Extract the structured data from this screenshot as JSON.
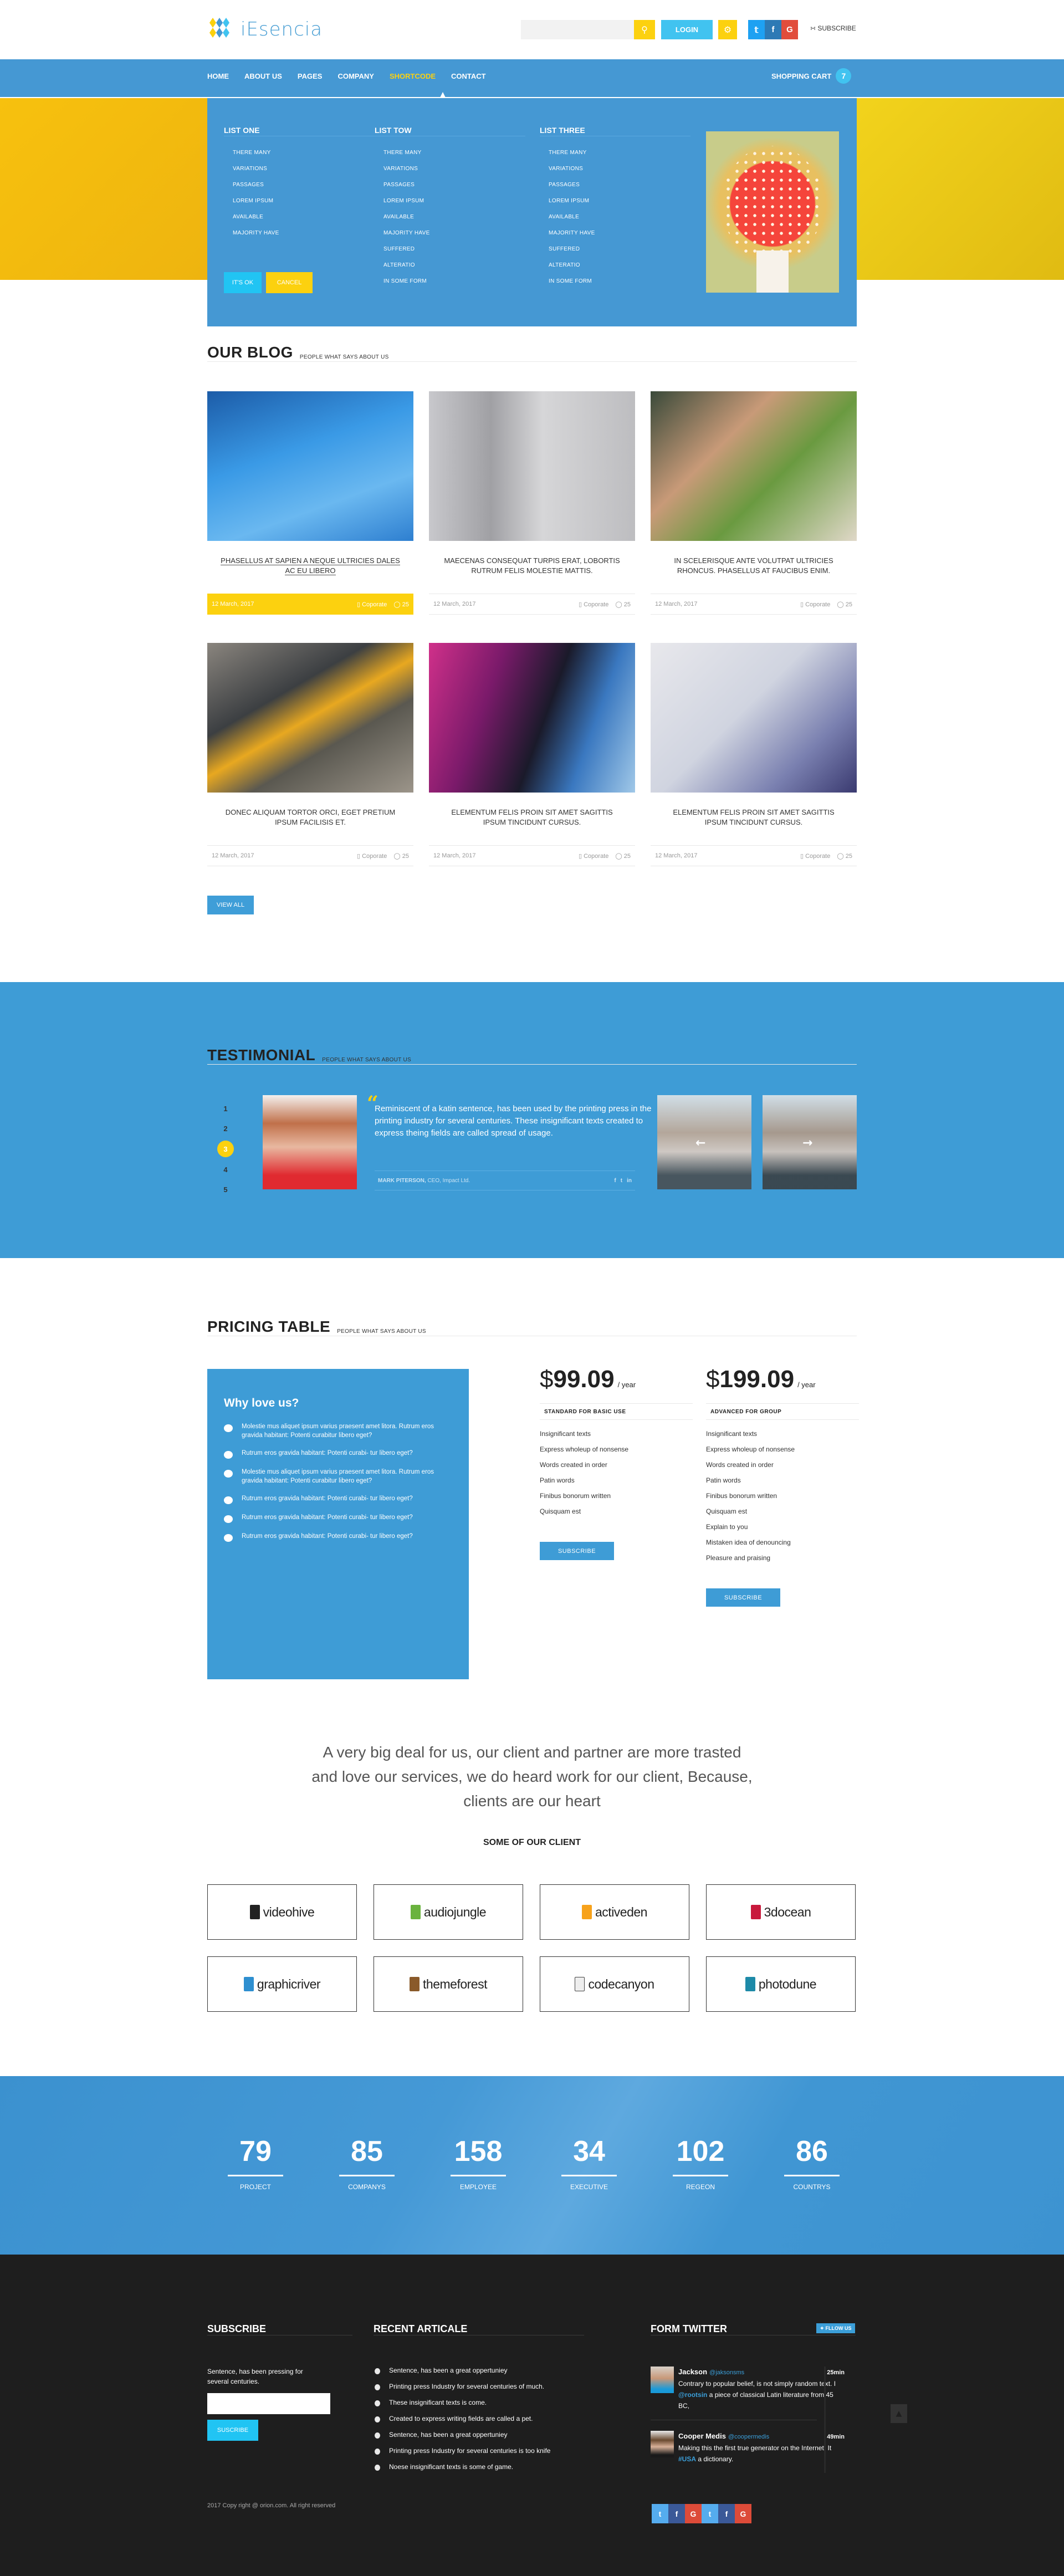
{
  "header": {
    "logo_text": "iEsencia",
    "search_placeholder": "",
    "search_icon": "search-icon",
    "login_label": "LOGIN",
    "settings_icon": "gear-icon",
    "social": [
      {
        "name": "twitter",
        "glyph": "t",
        "color": "#1ea1f2"
      },
      {
        "name": "facebook",
        "glyph": "f",
        "color": "#2d7ab5"
      },
      {
        "name": "google",
        "glyph": "G",
        "color": "#e14d3c"
      }
    ],
    "subscribe_label": "SUBSCRIBE",
    "subscribe_icon": "rss-icon"
  },
  "nav": {
    "items": [
      "HOME",
      "ABOUT US",
      "PAGES",
      "COMPANY",
      "SHORTCODE",
      "CONTACT"
    ],
    "active": "SHORTCODE",
    "cart_label": "SHOPPING CART",
    "cart_count": "7"
  },
  "mega_menu": {
    "lists": [
      {
        "title": "LIST ONE",
        "items": [
          "THERE MANY",
          "VARIATIONS",
          "PASSAGES",
          "LOREM IPSUM",
          "AVAILABLE",
          "MAJORITY HAVE"
        ]
      },
      {
        "title": "LIST TOW",
        "items": [
          "THERE MANY",
          "VARIATIONS",
          "PASSAGES",
          "LOREM IPSUM",
          "AVAILABLE",
          "MAJORITY HAVE",
          "SUFFERED",
          "ALTERATIO",
          "IN SOME FORM"
        ]
      },
      {
        "title": "LIST THREE",
        "items": [
          "THERE MANY",
          "VARIATIONS",
          "PASSAGES",
          "LOREM IPSUM",
          "AVAILABLE",
          "MAJORITY HAVE",
          "SUFFERED",
          "ALTERATIO",
          "IN SOME FORM"
        ]
      }
    ],
    "ok_label": "IT'S OK",
    "cancel_label": "CANCEL",
    "image": "mushroom-photo"
  },
  "blog": {
    "title": "OUR BLOG",
    "subtitle": "PEOPLE WHAT SAYS ABOUT US",
    "posts": [
      {
        "title": "PHASELLUS AT SAPIEN A NEQUE ULTRICIES DALES AC EU LIBERO",
        "date": "12 March, 2017",
        "category": "Coporate",
        "comments": "25",
        "image": "building-photo",
        "highlighted": true
      },
      {
        "title": "MAECENAS CONSEQUAT TURPIS ERAT, LOBORTIS RUTRUM FELIS MOLESTIE MATTIS.",
        "date": "12 March, 2017",
        "category": "Coporate",
        "comments": "25",
        "image": "boy-singing-photo",
        "highlighted": false
      },
      {
        "title": "IN SCELERISQUE ANTE VOLUTPAT ULTRICIES RHONCUS. PHASELLUS AT FAUCIBUS ENIM.",
        "date": "12 March, 2017",
        "category": "Coporate",
        "comments": "25",
        "image": "kids-laptop-photo",
        "highlighted": false
      },
      {
        "title": "DONEC ALIQUAM TORTOR ORCI, EGET PRETIUM IPSUM FACILISIS ET.",
        "date": "12 March, 2017",
        "category": "Coporate",
        "comments": "25",
        "image": "shoes-photo",
        "highlighted": false
      },
      {
        "title": "ELEMENTUM FELIS PROIN SIT AMET SAGITTIS IPSUM TINCIDUNT CURSUS.",
        "date": "12 March, 2017",
        "category": "Coporate",
        "comments": "25",
        "image": "colorful-abstract-photo",
        "highlighted": false
      },
      {
        "title": "ELEMENTUM FELIS PROIN SIT AMET SAGITTIS IPSUM TINCIDUNT CURSUS.",
        "date": "12 March, 2017",
        "category": "Coporate",
        "comments": "25",
        "image": "drawing-chart-photo",
        "highlighted": false
      }
    ],
    "view_all_label": "VIEW ALL"
  },
  "testimonial": {
    "title": "TESTIMONIAL",
    "subtitle": "PEOPLE WHAT SAYS ABOUT US",
    "pages": [
      "1",
      "2",
      "3",
      "4",
      "5"
    ],
    "active_page": "3",
    "quote": "Reminiscent of a katin sentence, has been used by the printing press in the printing industry for several centuries. These insignificant texts created to express theing fields are called spread of usage.",
    "author_name": "MARK PITERSON,",
    "author_role": "CEO, Impact Ltd.",
    "author_social": [
      "f",
      "t",
      "in"
    ]
  },
  "pricing": {
    "title": "PRICING TABLE",
    "subtitle": "PEOPLE WHAT SAYS ABOUT US",
    "why_title": "Why love us?",
    "why_items": [
      "Molestie mus aliquet ipsum varius praesent amet litora. Rutrum eros gravida habitant: Potenti curabitur libero eget?",
      "Rutrum eros gravida habitant: Potenti curabi- tur libero eget?",
      "Molestie mus aliquet ipsum varius praesent amet litora. Rutrum eros gravida habitant: Potenti curabitur libero eget?",
      "Rutrum eros gravida habitant: Potenti curabi- tur libero eget?",
      "Rutrum eros gravida habitant: Potenti curabi- tur libero eget?",
      "Rutrum eros gravida habitant: Potenti curabi- tur libero eget?"
    ],
    "plans": [
      {
        "currency": "$",
        "amount": "99.09",
        "period": "/ year",
        "name": "STANDARD FOR BASIC USE",
        "features": [
          "Insignificant texts",
          "Express wholeup of nonsense",
          "Words created in order",
          "Patin words",
          "Finibus bonorum written",
          "Quisquam est"
        ],
        "button": "SUBSCRIBE"
      },
      {
        "currency": "$",
        "amount": "199.09",
        "period": "/ year",
        "name": "ADVANCED FOR GROUP",
        "features": [
          "Insignificant texts",
          "Express wholeup of nonsense",
          "Words created in order",
          "Patin words",
          "Finibus bonorum written",
          "Quisquam est",
          "Explain to you",
          "Mistaken idea of denouncing",
          "Pleasure and praising"
        ],
        "button": "SUBSCRIBE"
      }
    ]
  },
  "clients": {
    "statement": "A very big deal for us, our client and partner are more trasted and love our services, we do heard work for our client, Because, clients are our heart",
    "title": "SOME OF OUR CLIENT",
    "logos": [
      {
        "name": "videohive",
        "color": "#222"
      },
      {
        "name": "audiojungle",
        "color": "#6ab33e"
      },
      {
        "name": "activeden",
        "color": "#f7a21b"
      },
      {
        "name": "3docean",
        "color": "#c8193c"
      },
      {
        "name": "graphicriver",
        "color": "#2e8fd0"
      },
      {
        "name": "themeforest",
        "color": "#8a5a2a"
      },
      {
        "name": "codecanyon",
        "color": "#eeeeee"
      },
      {
        "name": "photodune",
        "color": "#1d8aa8"
      }
    ]
  },
  "stats": [
    {
      "value": "79",
      "label": "PROJECT"
    },
    {
      "value": "85",
      "label": "COMPANYS"
    },
    {
      "value": "158",
      "label": "EMPLOYEE"
    },
    {
      "value": "34",
      "label": "EXECUTIVE"
    },
    {
      "value": "102",
      "label": "REGEON"
    },
    {
      "value": "86",
      "label": "COUNTRYS"
    }
  ],
  "footer": {
    "subscribe_title": "SUBSCRIBE",
    "subscribe_text": "Sentence, has been pressing for several centuries.",
    "email_placeholder": "",
    "subscribe_button": "SUSCRIBE",
    "articles_title": "RECENT ARTICALE",
    "articles": [
      "Sentence, has been a great oppertuniey",
      "Printing press Industry for several centuries of much.",
      "These insignificant texts is come.",
      "Created to express writing fields are called a pet.",
      "Sentence, has been a great oppertuniey",
      "Printing press Industry for several centuries is too knife",
      "Noese insignificant texts is some of game."
    ],
    "twitter_title": "FORM TWITTER",
    "follow_label": "FLLOW US",
    "tweets": [
      {
        "name": "Jackson",
        "handle": "@jaksonsms",
        "time": "25min",
        "pre": "Contrary to popular belief, is not simply random text. I ",
        "link": "@rootsin",
        "post": " a piece of classical Latin literature from 45 BC,"
      },
      {
        "name": "Cooper Medis",
        "handle": "@coopermedis",
        "time": "49min",
        "pre": "Making this the first true generator on the Internet. It ",
        "link": "#USA",
        "post": " a dictionary."
      }
    ],
    "copyright": "2017 Copy right @ orion.com. All right reserved",
    "social": [
      {
        "name": "twitter",
        "glyph": "t",
        "color": "#55acee"
      },
      {
        "name": "facebook",
        "glyph": "f",
        "color": "#3b5998"
      },
      {
        "name": "google",
        "glyph": "G",
        "color": "#dd4b39"
      },
      {
        "name": "twitter",
        "glyph": "t",
        "color": "#55acee"
      },
      {
        "name": "facebook",
        "glyph": "f",
        "color": "#3b5998"
      },
      {
        "name": "google",
        "glyph": "G",
        "color": "#dd4b39"
      }
    ]
  }
}
